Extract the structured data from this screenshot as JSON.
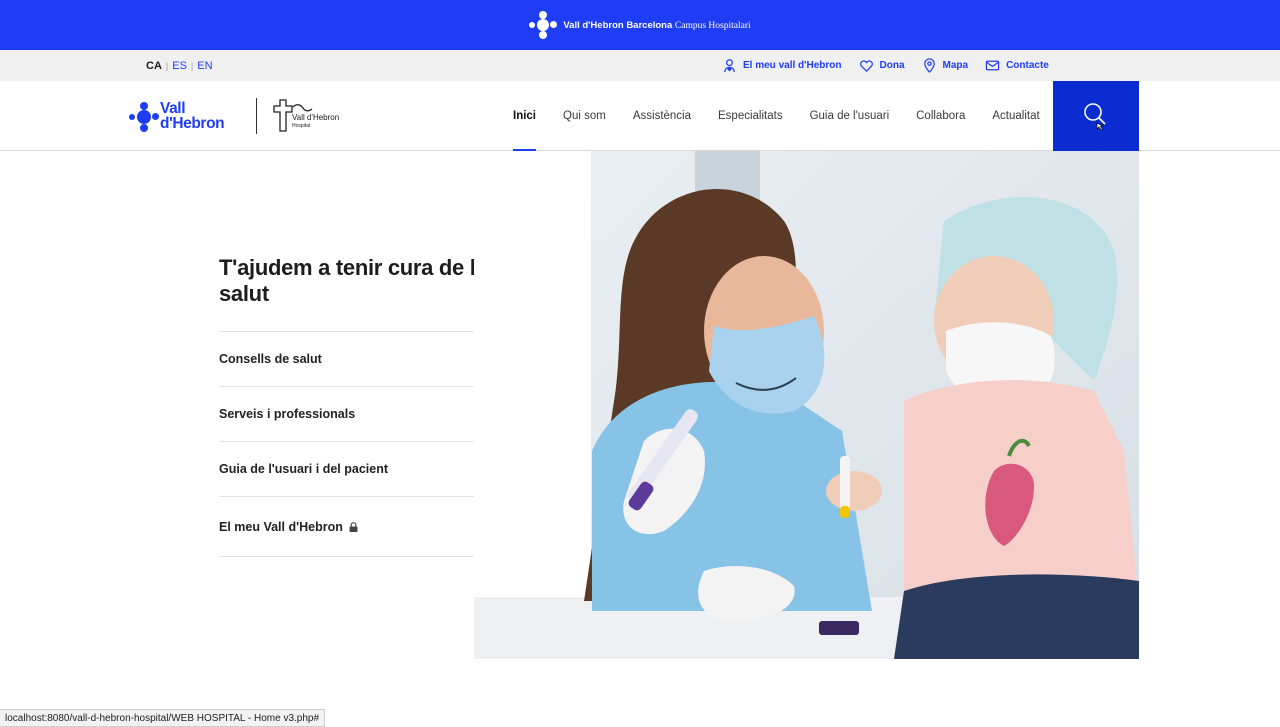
{
  "campus_bar": {
    "brand_bold": "Vall d'Hebron Barcelona",
    "brand_rest": "Campus Hospitalari",
    "background": "#1f3df5"
  },
  "utility": {
    "languages": [
      {
        "code": "CA",
        "active": true
      },
      {
        "code": "ES",
        "active": false
      },
      {
        "code": "EN",
        "active": false
      }
    ],
    "links": [
      {
        "label": "El meu vall d'Hebron",
        "icon": "user-heart-icon"
      },
      {
        "label": "Dona",
        "icon": "heart-icon"
      },
      {
        "label": "Mapa",
        "icon": "map-pin-icon"
      },
      {
        "label": "Contacte",
        "icon": "envelope-icon"
      }
    ]
  },
  "header": {
    "logo_line1": "Vall",
    "logo_line2": "d'Hebron",
    "hospital_name": "Vall d'Hebron",
    "hospital_sub": "Hospital",
    "nav": [
      {
        "label": "Inici",
        "active": true
      },
      {
        "label": "Qui som",
        "active": false
      },
      {
        "label": "Assistència",
        "active": false
      },
      {
        "label": "Especialitats",
        "active": false
      },
      {
        "label": "Guia de l'usuari",
        "active": false
      },
      {
        "label": "Collabora",
        "active": false
      },
      {
        "label": "Actualitat",
        "active": false
      }
    ],
    "accent": "#1f3df5",
    "search_bg": "#0a2cd1"
  },
  "hero": {
    "title": "T'ajudem a tenir cura de la teva salut",
    "items": [
      {
        "label": "Consells de salut",
        "locked": false
      },
      {
        "label": "Serveis i professionals",
        "locked": false
      },
      {
        "label": "Guia de l'usuari i del pacient",
        "locked": false
      },
      {
        "label": "El meu Vall d'Hebron",
        "locked": true
      }
    ]
  },
  "status_bar": {
    "url": "localhost:8080/vall-d-hebron-hospital/WEB HOSPITAL - Home v3.php#"
  }
}
